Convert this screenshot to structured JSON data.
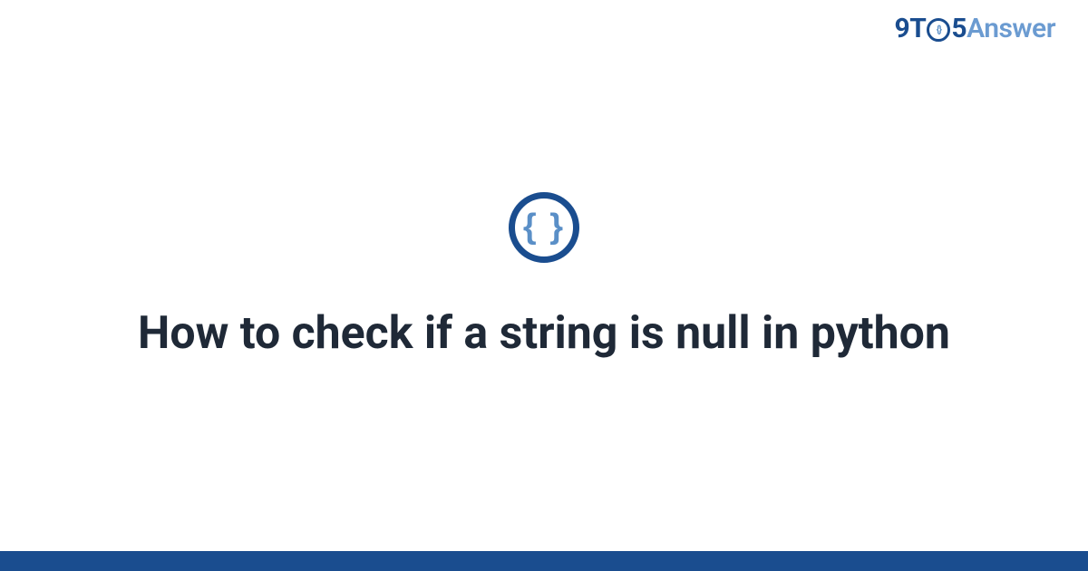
{
  "header": {
    "logo": {
      "part_9t": "9T",
      "part_o_inner": "{}",
      "part_5": "5",
      "part_answer": "Answer"
    }
  },
  "main": {
    "icon_braces": "{ }",
    "title": "How to check if a string is null in python"
  },
  "colors": {
    "brand_dark": "#1a4d8f",
    "brand_light": "#6b9bd1",
    "text": "#1f2937"
  }
}
